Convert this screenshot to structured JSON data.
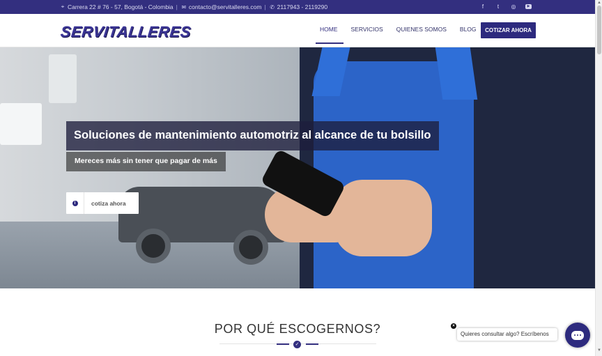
{
  "topbar": {
    "address": "Carrera 22 # 76 - 57, Bogotá - Colombia",
    "email": "contacto@servitalleres.com",
    "phone": "2117943 - 2119290",
    "separator": "|",
    "social": [
      "facebook-icon",
      "twitter-icon",
      "instagram-icon",
      "youtube-icon"
    ]
  },
  "brand": {
    "logo_text": "SERVITALLERES",
    "color": "#332f7f"
  },
  "nav": {
    "items": [
      {
        "label": "HOME",
        "active": true
      },
      {
        "label": "SERVICIOS",
        "active": false
      },
      {
        "label": "QUIENES SOMOS",
        "active": false
      },
      {
        "label": "BLOG",
        "active": false
      }
    ],
    "cta": "COTIZAR AHORA"
  },
  "hero": {
    "title": "Soluciones de mantenimiento automotriz al alcance de tu bolsillo",
    "subtitle": "Mereces más sin tener que pagar de más",
    "button_label": "cotiza ahora",
    "button_icon": "info-icon"
  },
  "section": {
    "title": "POR QUÉ ESCOGERNOS?",
    "icon": "check-circle-icon"
  },
  "chat": {
    "bubble_text": "Quieres consultar algo? Escríbenos",
    "close_glyph": "×",
    "icon": "chat-icon"
  },
  "colors": {
    "primary": "#332f7f",
    "cta": "#2d2a7e",
    "topbar_text": "#dcdcf2"
  }
}
